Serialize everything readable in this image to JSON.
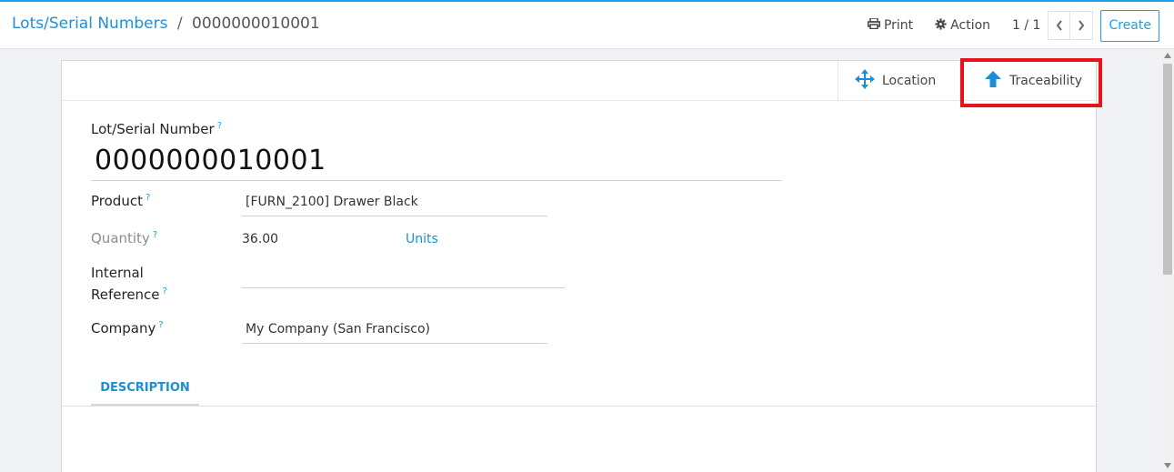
{
  "breadcrumb": {
    "parent": "Lots/Serial Numbers",
    "separator": "/",
    "current": "0000000010001"
  },
  "toolbar": {
    "print_label": "Print",
    "action_label": "Action",
    "pager": "1 / 1",
    "create_label": "Create"
  },
  "smart_buttons": {
    "location_label": "Location",
    "traceability_label": "Traceability"
  },
  "form": {
    "lot_label": "Lot/Serial Number",
    "lot_value": "0000000010001",
    "product_label": "Product",
    "product_value": "[FURN_2100] Drawer Black",
    "quantity_label": "Quantity",
    "quantity_value": "36.00",
    "quantity_uom": "Units",
    "internal_ref_label_1": "Internal",
    "internal_ref_label_2": "Reference",
    "internal_ref_value": "",
    "company_label": "Company",
    "company_value": "My Company (San Francisco)",
    "help_mark": "?"
  },
  "tabs": {
    "description_label": "DESCRIPTION"
  },
  "colors": {
    "accent": "#1a9fe8",
    "highlight": "#e8121b"
  },
  "icons": {
    "print": "printer-icon",
    "action": "gear-icon",
    "prev": "chevron-left-icon",
    "next": "chevron-right-icon",
    "location": "arrows-move-icon",
    "traceability": "arrow-up-icon"
  }
}
